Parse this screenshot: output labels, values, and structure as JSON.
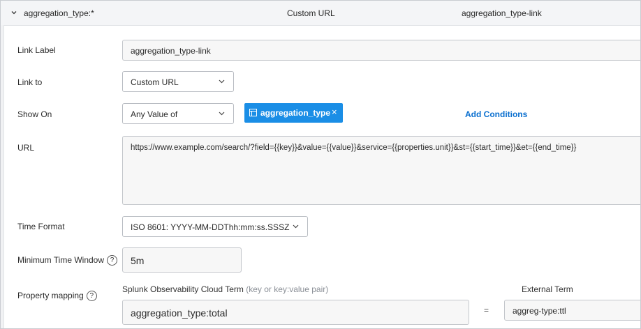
{
  "header": {
    "name": "aggregation_type:*",
    "link_type": "Custom URL",
    "link_label": "aggregation_type-link"
  },
  "form": {
    "link_label": {
      "label": "Link Label",
      "value": "aggregation_type-link"
    },
    "link_to": {
      "label": "Link to",
      "value": "Custom URL"
    },
    "show_on": {
      "label": "Show On",
      "value": "Any Value of",
      "chip": "aggregation_type",
      "chip_remove": "×",
      "add_conditions": "Add Conditions"
    },
    "url": {
      "label": "URL",
      "value": "https://www.example.com/search/?field={{key}}&value={{value}}&service={{properties.unit}}&st={{start_time}}&et={{end_time}}"
    },
    "time_format": {
      "label": "Time Format",
      "value": "ISO 8601: YYYY-MM-DDThh:mm:ss.SSSZ"
    },
    "min_time_window": {
      "label": "Minimum Time Window",
      "help": "?",
      "value": "5m"
    },
    "property_mapping": {
      "label": "Property mapping",
      "help": "?",
      "splunk_term_heading": "Splunk Observability Cloud Term",
      "splunk_term_hint": "(key or key:value pair)",
      "external_term_heading": "External Term",
      "equals": "=",
      "splunk_value": "aggregation_type:total",
      "external_value": "aggreg-type:ttl"
    }
  },
  "colors": {
    "accent": "#1a8ee6",
    "link": "#0a6fcf",
    "header_bg": "#f4f5f7"
  },
  "icons": {
    "collapse": "chevron-down-icon",
    "caret": "chevron-down-icon",
    "chip": "dimension-icon",
    "help": "question-circle-icon"
  }
}
